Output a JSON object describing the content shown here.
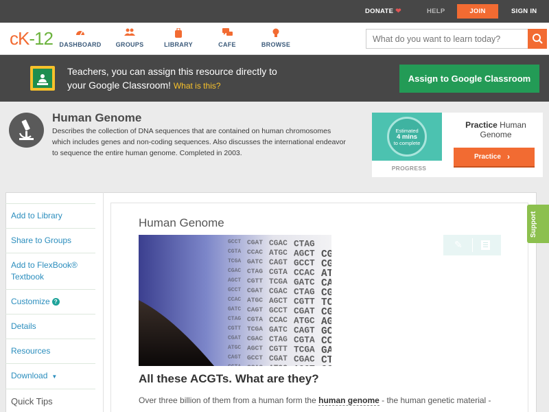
{
  "topbar": {
    "donate": "DONATE",
    "help": "HELP",
    "join": "JOIN",
    "signin": "SIGN IN",
    "colors": {
      "bg": "#474747",
      "join_bg": "#f26b32",
      "heart": "#e05555"
    }
  },
  "nav": {
    "logo": {
      "c": "c",
      "k": "K",
      "dash": "-",
      "n": "12"
    },
    "items": [
      {
        "label": "DASHBOARD",
        "icon": "dashboard-gauge-icon"
      },
      {
        "label": "GROUPS",
        "icon": "groups-people-icon"
      },
      {
        "label": "LIBRARY",
        "icon": "library-backpack-icon"
      },
      {
        "label": "CAFE",
        "icon": "cafe-chat-icon"
      },
      {
        "label": "BROWSE",
        "icon": "browse-lightbulb-icon"
      }
    ],
    "search": {
      "placeholder": "What do you want to learn today?",
      "icon": "search-icon"
    },
    "accent": "#f26b32"
  },
  "classroom_banner": {
    "line1": "Teachers, you can assign this resource directly to",
    "line2": "your Google Classroom!",
    "what_link": "What is this?",
    "assign_button": "Assign to Google Classroom",
    "colors": {
      "button": "#239b56",
      "link": "#f7c12b"
    }
  },
  "concept": {
    "icon": "microscope-icon",
    "title": "Human Genome",
    "description": "Describes the collection of DNA sequences that are contained on human chromosomes which includes genes and non-coding sequences. Also discusses the international endeavor to sequence the entire human genome. Completed in 2003."
  },
  "practice_card": {
    "estimate_line1": "Estimated",
    "estimate_line2": "4 mins",
    "estimate_line3": "to complete",
    "progress_label": "PROGRESS",
    "title_bold": "Practice",
    "title_rest": "Human Genome",
    "button_label": "Practice"
  },
  "sidebar": {
    "items": [
      {
        "label": "Add to Library"
      },
      {
        "label": "Share to Groups"
      },
      {
        "label": "Add to FlexBook® Textbook"
      },
      {
        "label": "Customize"
      },
      {
        "label": "Details"
      },
      {
        "label": "Resources"
      },
      {
        "label": "Download"
      }
    ],
    "quick_tips": "Quick Tips"
  },
  "article": {
    "title": "Human Genome",
    "image_alt_text_letters": [
      "GCCT",
      "CGAT",
      "CGAC",
      "CTAG",
      "CGTA",
      "CCAC",
      "ATGC",
      "AGCT",
      "CGTT",
      "TCGA",
      "GATC",
      "CAGT"
    ],
    "heading": "All these ACGTs. What are they?",
    "para_before": "Over three billion of them from a human form the ",
    "para_term": "human genome",
    "para_after": " - the human genetic material -",
    "tools": [
      "pencil-edit-icon",
      "notes-list-icon"
    ]
  },
  "support_tab": "Support"
}
